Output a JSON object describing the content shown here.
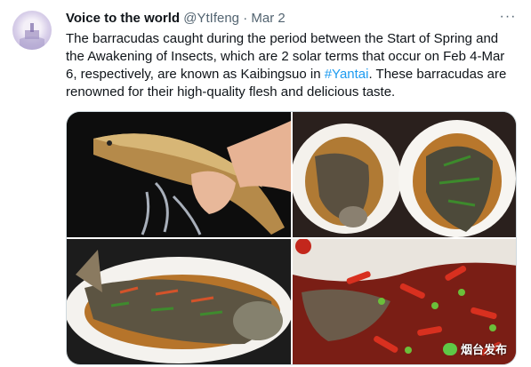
{
  "tweet": {
    "author_name": "Voice to the world",
    "handle": "@YtIfeng",
    "separator": "·",
    "date": "Mar 2",
    "more_label": "···",
    "text_before": "The barracudas caught during the period between the Start of Spring and the Awakening of Insects, which are 2 solar terms that occur on Feb 4-Mar 6, respectively, are known as Kaibingsuo in ",
    "hashtag": "#Yantai",
    "text_after": ". These barracudas are renowned for their high-quality flesh and delicious taste."
  },
  "media": {
    "watermark": "烟台发布"
  },
  "colors": {
    "link": "#1d9bf0",
    "secondary_text": "#536471",
    "border": "#cfd9de"
  }
}
